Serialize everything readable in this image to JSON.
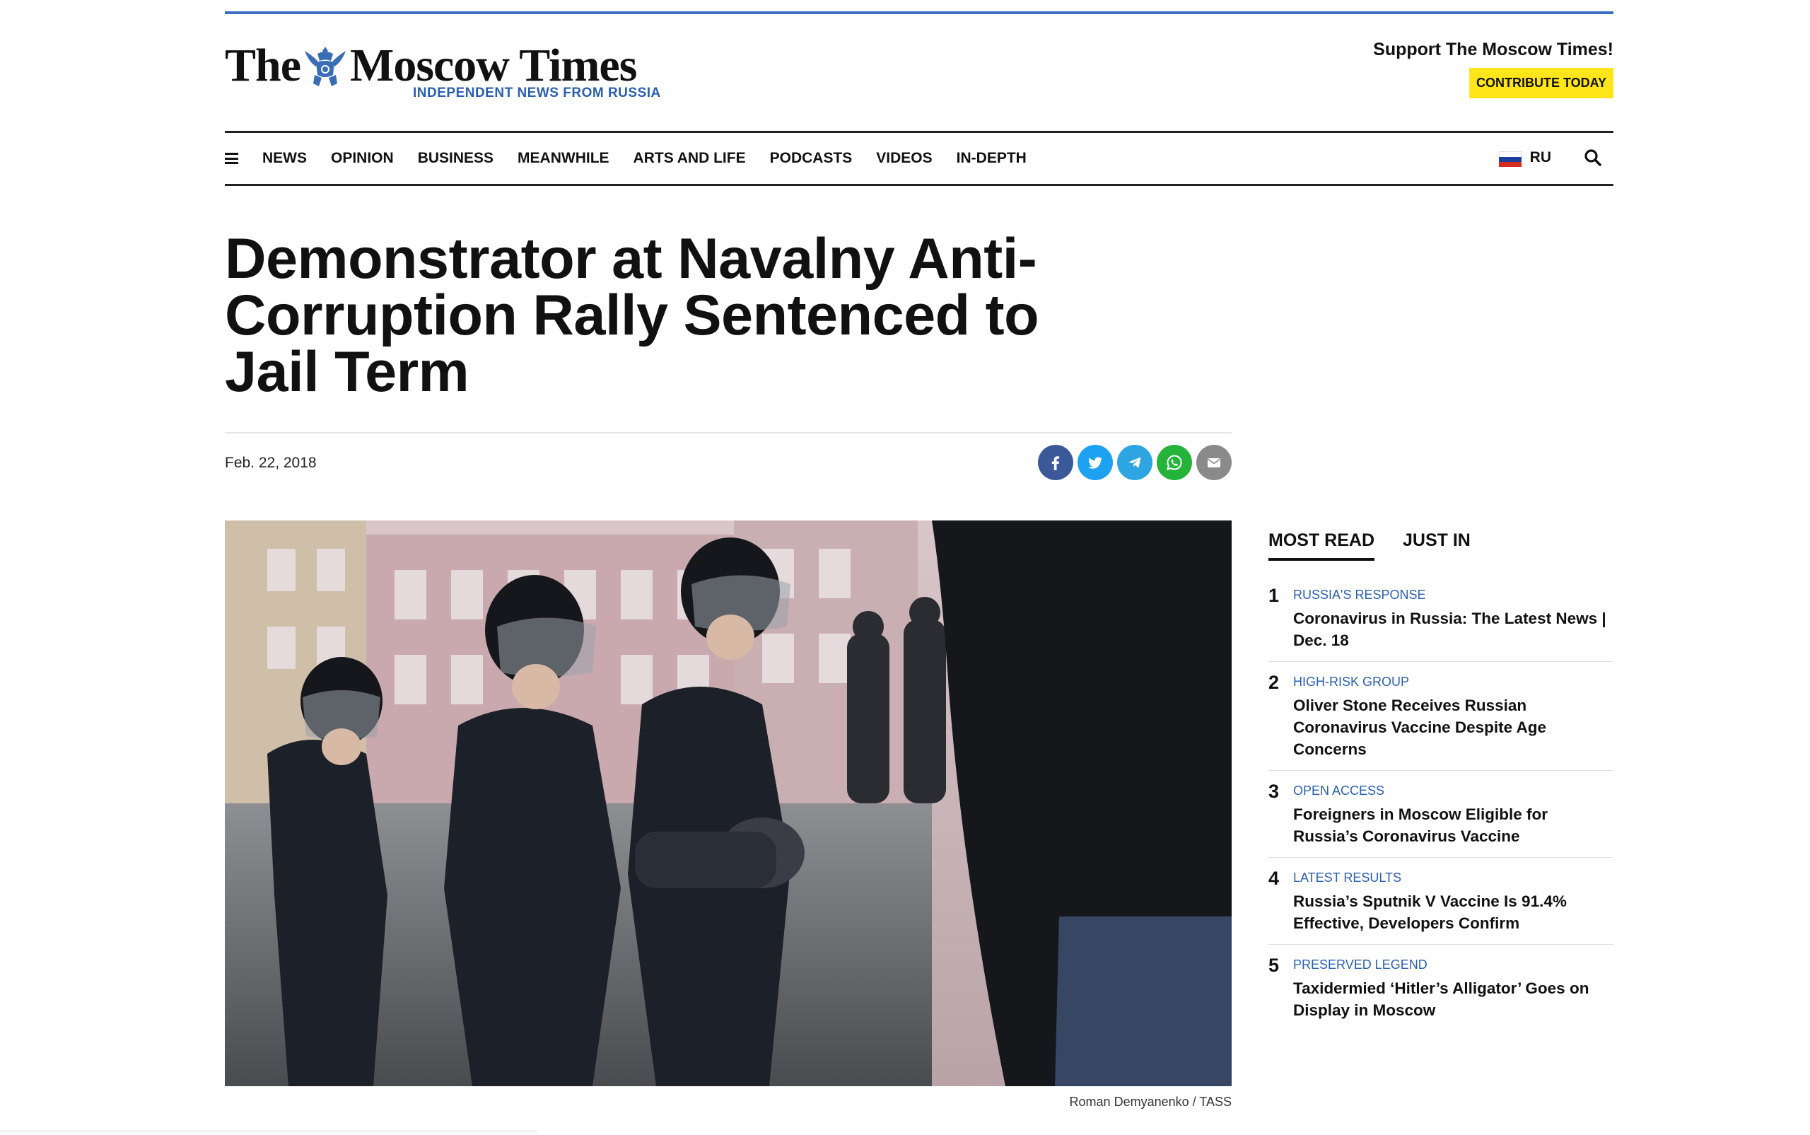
{
  "header": {
    "logo_left": "The",
    "logo_right": "Moscow Times",
    "tagline": "INDEPENDENT NEWS FROM RUSSIA",
    "support_text": "Support The Moscow Times!",
    "contribute_label": "CONTRIBUTE TODAY"
  },
  "nav": {
    "items": [
      "NEWS",
      "OPINION",
      "BUSINESS",
      "MEANWHILE",
      "ARTS AND LIFE",
      "PODCASTS",
      "VIDEOS",
      "IN-DEPTH"
    ],
    "lang": "RU"
  },
  "article": {
    "title": "Demonstrator at Navalny Anti-Corruption Rally Sentenced to Jail Term",
    "date": "Feb. 22, 2018",
    "photo_credit": "Roman Demyanenko / TASS"
  },
  "share": [
    {
      "name": "facebook-icon",
      "color": "#3b5998"
    },
    {
      "name": "twitter-icon",
      "color": "#1da1f2"
    },
    {
      "name": "telegram-icon",
      "color": "#2ca5e0"
    },
    {
      "name": "whatsapp-icon",
      "color": "#25b33a"
    },
    {
      "name": "email-icon",
      "color": "#8a8a8a"
    }
  ],
  "sidebar": {
    "tabs": [
      "MOST READ",
      "JUST IN"
    ],
    "items": [
      {
        "num": "1",
        "category": "Russia's Response",
        "title": "Coronavirus in Russia: The Latest News | Dec. 18"
      },
      {
        "num": "2",
        "category": "High-Risk Group",
        "title": "Oliver Stone Receives Russian Coronavirus Vaccine Despite Age Concerns"
      },
      {
        "num": "3",
        "category": "Open Access",
        "title": "Foreigners in Moscow Eligible for Russia’s Coronavirus Vaccine"
      },
      {
        "num": "4",
        "category": "Latest Results",
        "title": "Russia’s Sputnik V Vaccine Is 91.4% Effective, Developers Confirm"
      },
      {
        "num": "5",
        "category": "Preserved Legend",
        "title": "Taxidermied ‘Hitler’s Alligator’ Goes on Display in Moscow"
      }
    ]
  },
  "colors": {
    "accent_blue": "#2a5fae",
    "contribute_yellow": "#ffe51a"
  }
}
